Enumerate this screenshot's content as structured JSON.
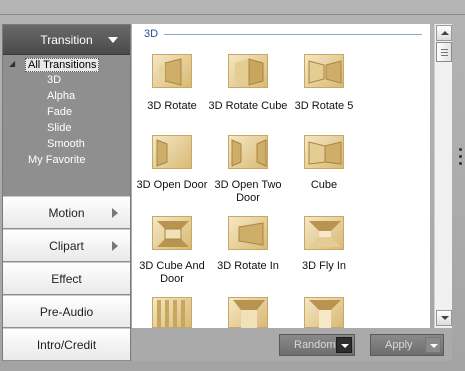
{
  "sidebar": {
    "header_label": "Transition",
    "tree": {
      "root": "All Transitions",
      "children": [
        "3D",
        "Alpha",
        "Fade",
        "Slide",
        "Smooth"
      ],
      "favorite": "My Favorite"
    },
    "buttons": [
      {
        "label": "Motion",
        "has_arrow": true
      },
      {
        "label": "Clipart",
        "has_arrow": true
      },
      {
        "label": "Effect",
        "has_arrow": false
      },
      {
        "label": "Pre-Audio",
        "has_arrow": false
      },
      {
        "label": "Intro/Credit",
        "has_arrow": false
      }
    ]
  },
  "content": {
    "section_title": "3D",
    "items": [
      {
        "label": "3D Rotate",
        "icon": "3d-rotate-icon"
      },
      {
        "label": "3D Rotate Cube",
        "icon": "3d-rotate-cube-icon"
      },
      {
        "label": "3D Rotate 5",
        "icon": "3d-rotate-5-icon"
      },
      {
        "label": "3D Open Door",
        "icon": "3d-open-door-icon"
      },
      {
        "label": "3D Open Two Door",
        "icon": "3d-open-two-door-icon"
      },
      {
        "label": "Cube",
        "icon": "cube-icon"
      },
      {
        "label": "3D Cube And Door",
        "icon": "3d-cube-and-door-icon"
      },
      {
        "label": "3D Rotate In",
        "icon": "3d-rotate-in-icon"
      },
      {
        "label": "3D Fly In",
        "icon": "3d-fly-in-icon"
      },
      {
        "label": "",
        "icon": "transition-thumbnail-icon"
      },
      {
        "label": "",
        "icon": "transition-thumbnail-icon"
      },
      {
        "label": "",
        "icon": "transition-thumbnail-icon"
      }
    ]
  },
  "bottombar": {
    "random_label": "Random",
    "apply_label": "Apply"
  },
  "colors": {
    "accent_title": "#2a4f9c",
    "thumb_gold": "#d9b976"
  }
}
